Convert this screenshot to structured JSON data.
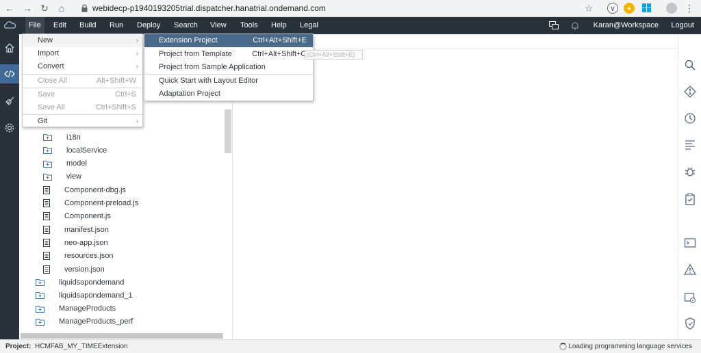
{
  "browser": {
    "url": "webidecp-p1940193205trial.dispatcher.hanatrial.ondemand.com"
  },
  "menubar": {
    "items": [
      "File",
      "Edit",
      "Build",
      "Run",
      "Deploy",
      "Search",
      "View",
      "Tools",
      "Help",
      "Legal"
    ],
    "user": "Karan@Workspace",
    "logout": "Logout"
  },
  "file_menu": {
    "items": [
      {
        "label": "New",
        "shortcut": "",
        "submenu": true,
        "disabled": false
      },
      {
        "label": "Import",
        "shortcut": "",
        "submenu": true,
        "disabled": false
      },
      {
        "label": "Convert",
        "shortcut": "",
        "submenu": true,
        "disabled": false
      },
      {
        "label": "Close All",
        "shortcut": "Alt+Shift+W",
        "submenu": false,
        "disabled": true
      },
      {
        "label": "Save",
        "shortcut": "Ctrl+S",
        "submenu": false,
        "disabled": true
      },
      {
        "label": "Save All",
        "shortcut": "Ctrl+Shift+S",
        "submenu": false,
        "disabled": true
      },
      {
        "label": "Git",
        "shortcut": "",
        "submenu": true,
        "disabled": false
      }
    ]
  },
  "new_menu": {
    "items": [
      {
        "label": "Extension Project",
        "shortcut": "Ctrl+Alt+Shift+E"
      },
      {
        "label": "Project from Template",
        "shortcut": "Ctrl+Alt+Shift+O"
      },
      {
        "label": "Project from Sample Application",
        "shortcut": ""
      },
      {
        "label": "Quick Start with Layout Editor",
        "shortcut": ""
      },
      {
        "label": "Adaptation Project",
        "shortcut": ""
      }
    ],
    "tooltip": "(Ctrl+Alt+Shift+E)"
  },
  "tree": {
    "children": [
      {
        "label": "i18n",
        "type": "folder"
      },
      {
        "label": "localService",
        "type": "folder"
      },
      {
        "label": "model",
        "type": "folder"
      },
      {
        "label": "view",
        "type": "folder"
      },
      {
        "label": "Component-dbg.js",
        "type": "file"
      },
      {
        "label": "Component-preload.js",
        "type": "file"
      },
      {
        "label": "Component.js",
        "type": "file"
      },
      {
        "label": "manifest.json",
        "type": "file"
      },
      {
        "label": "neo-app.json",
        "type": "file"
      },
      {
        "label": "resources.json",
        "type": "file"
      },
      {
        "label": "version.json",
        "type": "file"
      }
    ],
    "roots": [
      {
        "label": "liquidsapondemand",
        "type": "folder"
      },
      {
        "label": "liquidsapondemand_1",
        "type": "folder"
      },
      {
        "label": "ManageProducts",
        "type": "folder"
      },
      {
        "label": "ManageProducts_perf",
        "type": "folder"
      }
    ]
  },
  "statusbar": {
    "project_label": "Project:",
    "project_value": "HCMFAB_MY_TIMEExtension",
    "loading": "Loading programming language services"
  }
}
